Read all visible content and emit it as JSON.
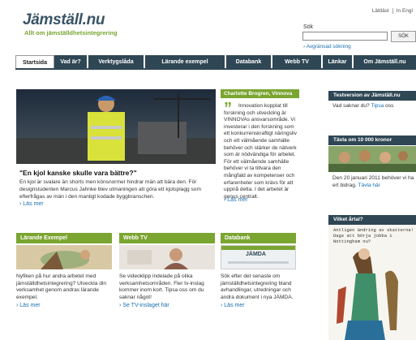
{
  "header": {
    "logo": "Jämställ.nu",
    "tagline": "Allt om jämställdhetsintegrering",
    "top_links": [
      "Lättläst",
      "In Engl"
    ],
    "search_label": "Sök",
    "search_button": "SÖK",
    "advanced_search": "Avgränsad sökning"
  },
  "nav": {
    "items": [
      "Startsida",
      "Vad är?",
      "Verktygslåda",
      "Lärande exempel",
      "Databank",
      "Webb TV",
      "Länkar",
      "Om Jämställ.nu"
    ],
    "active": "Startsida"
  },
  "hero": {
    "title": "\"En kjol kanske skulle vara bättre?\"",
    "text": "En kjol är svalare än shorts men könsnormer hindrar män att bära den. För designstudenten Marcus Jahnke blev utmaningen att göra ett kjolsplagg som efterfrågas av män i den manligt kodade byggbranschen.",
    "more": "Läs mer"
  },
  "quote": {
    "header": "Charlotte Brogren, Vinnova",
    "text": "Innovation kopplat till forskning och utveckling är VINNOVAs ansvarsområde. Vi investerar i den forskning som ett konkurrenskraftigt näringsliv och ett välmående samhälle behöver och stärker de nätverk som är nödvändiga för arbetet. För ett välmående samhälle behöver vi ta tillvara den mångfald av kompetenser och erfarenheter som krävs för att uppnå detta. I det arbetet är genus centralt.",
    "more": "Läs mer"
  },
  "boxes": [
    {
      "title": "Lärande Exempel",
      "text": "Nyfiken på hur andra arbetet med jämställdhetsintegrering? Utveckla din verksamhet genom andras lärande exempel.",
      "more": "Läs mer"
    },
    {
      "title": "Webb TV",
      "text": "Se videoklipp indelade på olika verksamhetsområden. Fler tv-inslag kommer inom kort. Tipsa oss om du saknar något!",
      "more": "Se TV-inslaget här"
    },
    {
      "title": "Databank",
      "text": "Sök efter det senaste om jämställdhetsintegrering bland avhandlingar, utredningar och andra dokument i nya JÄMDA.",
      "more": "Läs mer",
      "image_caption": "JÄMDA"
    }
  ],
  "right": {
    "test_title": "Testversion av Jämställ.nu",
    "test_text": "Vad saknar du?",
    "test_link": "Tipsa",
    "test_tail": "oss",
    "contest_title": "Tävla om 10 000 kronor",
    "contest_text": "Den 20 januari 2011 behöver vi ha ert bidrag.",
    "contest_link": "Tävla här",
    "year_title": "Vilket årtal?",
    "year_image_text": "Antligen ändring av skatterna! Dags att börja jobba i Nottingham nu?"
  },
  "colors": {
    "navy": "#2f4755",
    "green": "#7aa531",
    "link": "#1a6fb0"
  }
}
